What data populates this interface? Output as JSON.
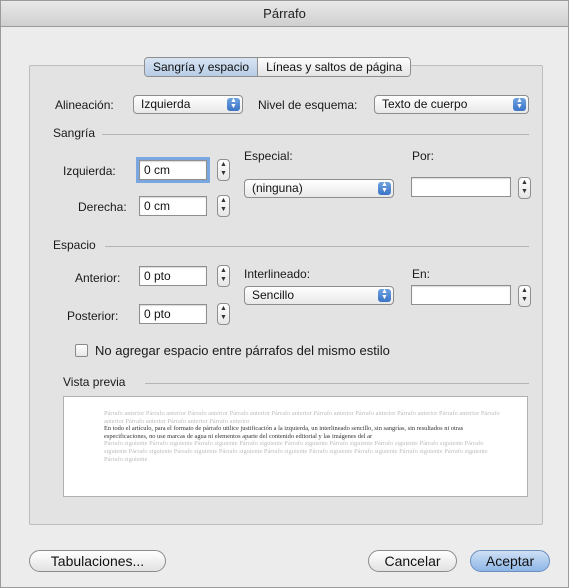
{
  "window": {
    "title": "Párrafo"
  },
  "tabs": [
    {
      "label": "Sangría y espacio",
      "active": true
    },
    {
      "label": "Líneas y saltos de página",
      "active": false
    }
  ],
  "alignment": {
    "label": "Alineación:",
    "value": "Izquierda"
  },
  "outline_level": {
    "label": "Nivel de esquema:",
    "value": "Texto de cuerpo"
  },
  "indent": {
    "section": "Sangría",
    "left_label": "Izquierda:",
    "left_value": "0 cm",
    "right_label": "Derecha:",
    "right_value": "0 cm",
    "special_label": "Especial:",
    "special_value": "(ninguna)",
    "by_label": "Por:",
    "by_value": ""
  },
  "spacing": {
    "section": "Espacio",
    "before_label": "Anterior:",
    "before_value": "0 pto",
    "after_label": "Posterior:",
    "after_value": "0 pto",
    "line_label": "Interlineado:",
    "line_value": "Sencillo",
    "at_label": "En:",
    "at_value": ""
  },
  "no_space_checkbox": {
    "label": "No agregar espacio entre párrafos del mismo estilo",
    "checked": false
  },
  "preview": {
    "section": "Vista previa",
    "before_text": "Párrafo anterior Párrafo anterior Párrafo anterior Párrafo anterior Párrafo anterior Párrafo anterior Párrafo anterior Párrafo anterior Párrafo anterior Párrafo anterior Párrafo anterior Párrafo anterior Párrafo anterior",
    "main_text": "En todo el artículo, para el formato de párrafo utilice justificación a la izquierda, un interlineado sencillo, sin sangrías, sin resultados ni otras especificaciones, no use marcas de agua ni elementos aparte del contenido editorial y las imágenes del ar",
    "after_text": "Párrafo siguiente Párrafo siguiente Párrafo siguiente Párrafo siguiente Párrafo siguiente Párrafo siguiente Párrafo siguiente Párrafo siguiente Párrafo siguiente Párrafo siguiente Párrafo siguiente Párrafo siguiente Párrafo siguiente Párrafo siguiente Párrafo siguiente Párrafo siguiente Párrafo siguiente Párrafo siguiente"
  },
  "buttons": {
    "tabs": "Tabulaciones...",
    "cancel": "Cancelar",
    "ok": "Aceptar"
  }
}
